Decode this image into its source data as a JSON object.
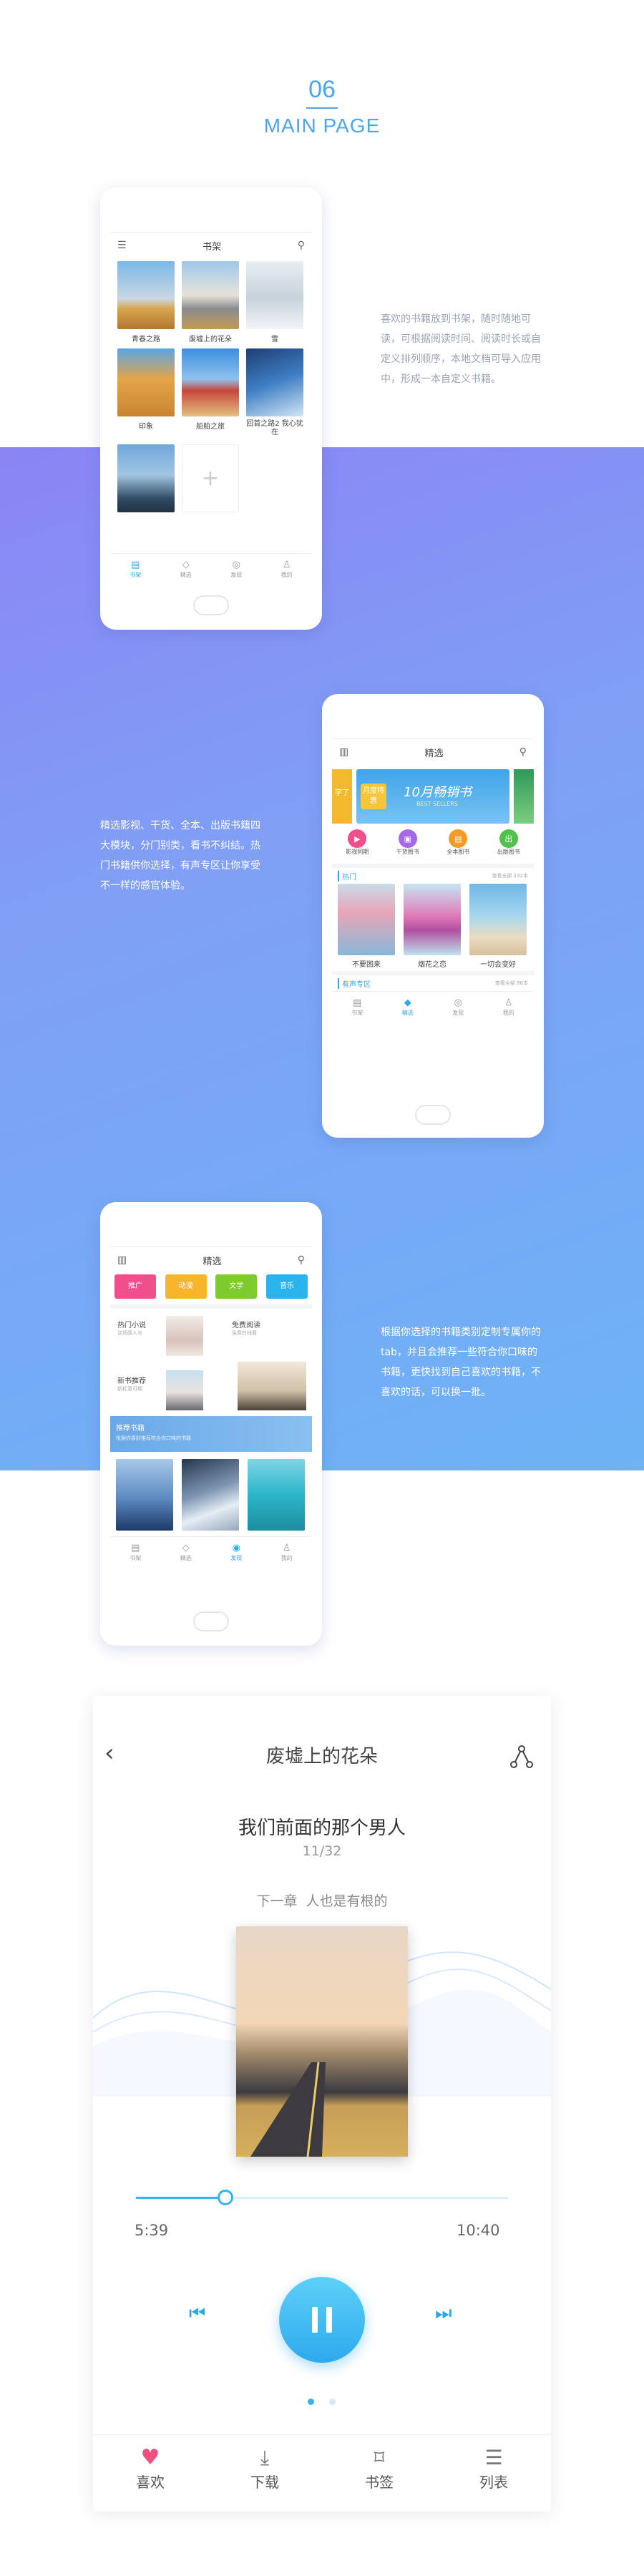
{
  "header": {
    "number": "06",
    "title": "MAIN PAGE"
  },
  "desc1": "喜欢的书籍放到书架，随时随地可读，可根据阅读时间、阅读时长或自定义排列顺序，本地文档可导入应用中，形成一本自定义书籍。",
  "desc2": "精选影视、干货、全本、出版书籍四大模块，分门别类，看书不纠结。热门书籍供你选择，有声专区让你享受不一样的感官体验。",
  "desc3": "根据你选择的书籍类别定制专属你的tab，并且会推荐一些符合你口味的书籍，更快找到自己喜欢的书籍，不喜欢的话，可以换一批。",
  "tabs": {
    "t1": "书架",
    "t2": "精选",
    "t3": "发现",
    "t4": "我的"
  },
  "shelf": {
    "title": "书架",
    "books": [
      "青春之路",
      "废墟上的花朵",
      "雪",
      "印象",
      "船舶之旅",
      "回首之路2 我心犹在"
    ]
  },
  "featured": {
    "title": "精选",
    "banner": "10月畅销书",
    "banner_sub": "BEST SELLERS",
    "left_tag": "字了",
    "mid_tag": "月度特惠",
    "cats": [
      "影视同期",
      "干货图书",
      "全本图书",
      "出版图书"
    ],
    "hot_label": "热门",
    "hot_more": "查看全部 232本",
    "hot_books": [
      "不要困来",
      "烟花之恋",
      "一切会变好"
    ],
    "audio_label": "有声专区",
    "audio_more": "查看全部 86本"
  },
  "custom": {
    "title": "精选",
    "chips": [
      "推广",
      "动漫",
      "文学",
      "音乐"
    ],
    "items": [
      {
        "title": "热门小说",
        "sub": "这场感人与"
      },
      {
        "title": "免费阅读",
        "sub": "免费在线看"
      },
      {
        "title": "新书推荐",
        "sub": "新标意可期"
      }
    ],
    "rec_title": "推荐书籍",
    "rec_sub": "根据你喜好推荐符合你口味的书籍"
  },
  "player": {
    "book": "废墟上的花朵",
    "chapter": "我们前面的那个男人",
    "page": "11/32",
    "next": "下一章  人也是有根的",
    "time_now": "5:39",
    "time_total": "10:40",
    "progress": 0.24,
    "nav": [
      "喜欢",
      "下载",
      "书签",
      "列表"
    ]
  }
}
